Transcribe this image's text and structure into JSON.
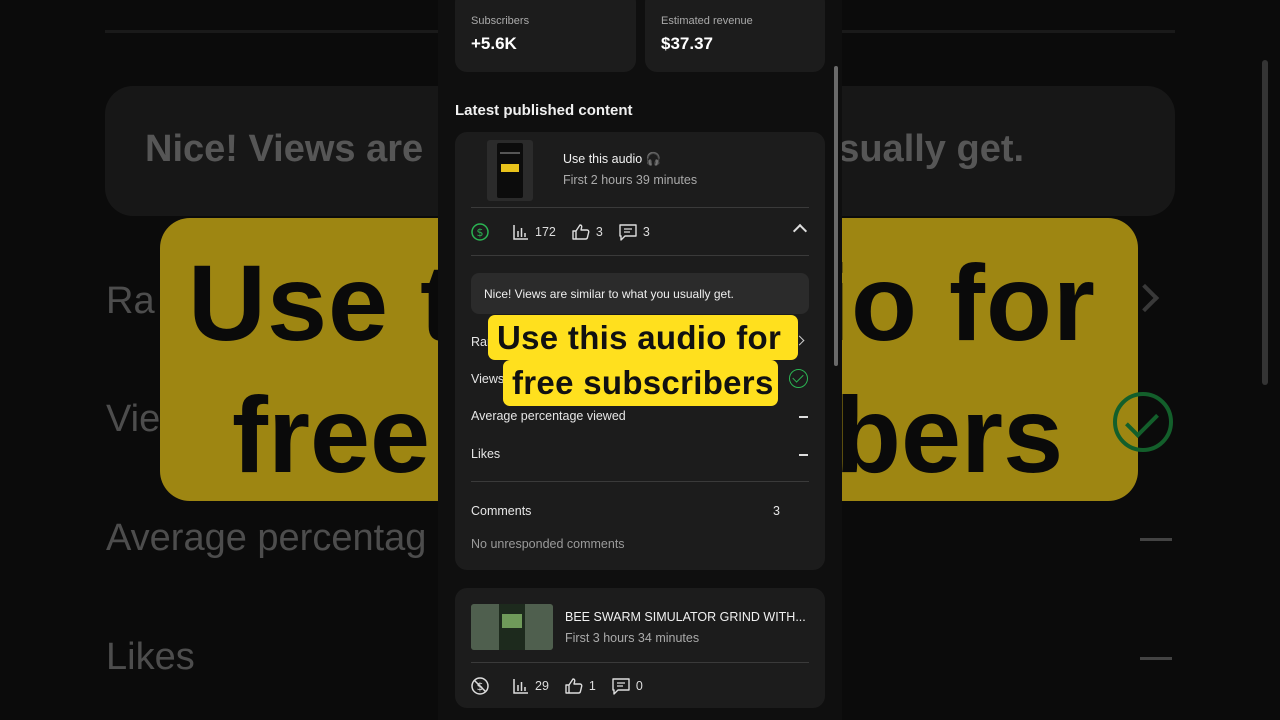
{
  "background": {
    "note_text_left": "Nice! Views are",
    "note_text_right": "usually get.",
    "sticker_line1_left": "Use t",
    "sticker_line1_right": "io for",
    "sticker_line2_left": "free",
    "sticker_line2_right": "bers",
    "row1": "Ra",
    "row2": "Vie",
    "row3": "Average percentag",
    "row4": "Likes"
  },
  "stats": [
    {
      "label": "Subscribers",
      "value": "+5.6K"
    },
    {
      "label": "Estimated revenue",
      "value": "$37.37"
    }
  ],
  "section_title": "Latest published content",
  "videos": [
    {
      "title": "Use this audio 🎧",
      "subtitle": "First 2 hours 39 minutes",
      "views": "172",
      "likes": "3",
      "comments": "3",
      "insight": "Nice! Views are similar to what you usually get.",
      "rows": [
        {
          "label": "Ranking"
        },
        {
          "label": "Views"
        },
        {
          "label": "Average percentage viewed"
        },
        {
          "label": "Likes"
        }
      ],
      "comments_label": "Comments",
      "comments_count": "3",
      "comments_status": "No unresponded comments"
    },
    {
      "title": "BEE SWARM SIMULATOR GRIND WITH...",
      "subtitle": "First 3 hours 34 minutes",
      "views": "29",
      "likes": "1",
      "comments": "0"
    }
  ],
  "sticker": {
    "line1": "Use this audio for",
    "line2": "free subscribers"
  },
  "colors": {
    "accent_yellow": "#ffe01e",
    "monetized_green": "#2bb553",
    "card_bg": "#1c1c1c"
  }
}
